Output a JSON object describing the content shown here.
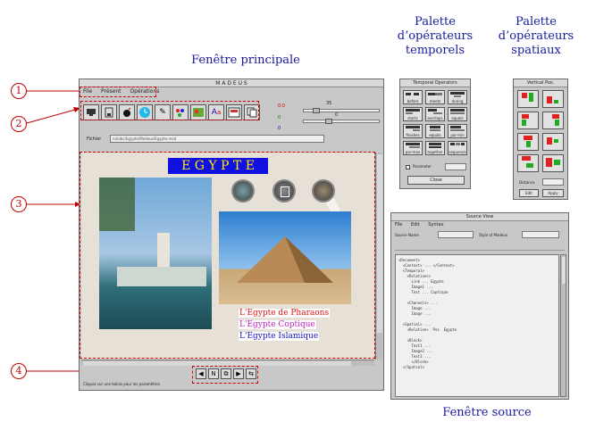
{
  "captions": {
    "main": "Fenêtre principale",
    "temporal_palette": [
      "Palette",
      "d’opérateurs",
      "temporels"
    ],
    "spatial_palette": [
      "Palette",
      "d’opérateurs",
      "spatiaux"
    ],
    "source": "Fenêtre source"
  },
  "callouts": [
    "1",
    "2",
    "3",
    "4"
  ],
  "main_window": {
    "title": "M A D E U S",
    "menu": [
      "File",
      "Présent",
      "Opérations"
    ],
    "toolbar_icons": [
      "monitor-icon",
      "save-icon",
      "bomb-icon",
      "clock-icon",
      "text-icon",
      "palette-icon",
      "image-icon",
      "font-icon",
      "document-icon",
      "copy-icon"
    ],
    "slider_labels": [
      "0:0",
      "0",
      "0"
    ],
    "slider_values": [
      "35",
      "0"
    ],
    "file_label": "Fichier",
    "file_path": "/u/labc/Egypte/Madeus/Egypte.mad",
    "presentation": {
      "title": "E G Y P T E",
      "links": [
        "L'Egypte de Pharaons",
        "L'Egypte Coptique",
        "L'Egypte Islamique"
      ],
      "link_colors": [
        "#e01010",
        "#c020c0",
        "#1010c0"
      ]
    },
    "nav_buttons": [
      "◀",
      "N",
      "⧉",
      "▶",
      "⇆"
    ],
    "status": "Cliquez sur une balise pour les paramètres."
  },
  "temporal_window": {
    "title": "Temporal Operators",
    "operators": [
      "before",
      "meets",
      "during",
      "starts",
      "overlaps",
      "equals",
      "finishes",
      "equals",
      "par-min",
      "par-max",
      "together",
      "sequence"
    ],
    "param_label": "Parameter",
    "button": "Close"
  },
  "spatial_window": {
    "title": "Vertical Pos.",
    "distance_label": "Distance",
    "buttons": [
      "Edit",
      "Apply"
    ]
  },
  "source_window": {
    "title": "Source View",
    "menu": [
      "File",
      "Edit",
      "Syntax"
    ],
    "fields": [
      "Source Name",
      "Style of Madeus"
    ],
    "code_lines": [
      "<Document>",
      "  <Context> ... </Context>",
      "  <Temporal>",
      "    <Relations>",
      "      Link ... Egypte",
      "      Image1 ...",
      "      Text ... Coptique",
      "",
      "    <Channels> ...",
      "      Image ...",
      "      Image ...",
      "",
      "  <Spatial> ...",
      "    <Relation>  Pos  Egypte",
      "",
      "    <Block>",
      "      Text1 ...",
      "      Image2 ...",
      "      Text3 ...",
      "      </Block>",
      "  </Spatial>"
    ]
  }
}
